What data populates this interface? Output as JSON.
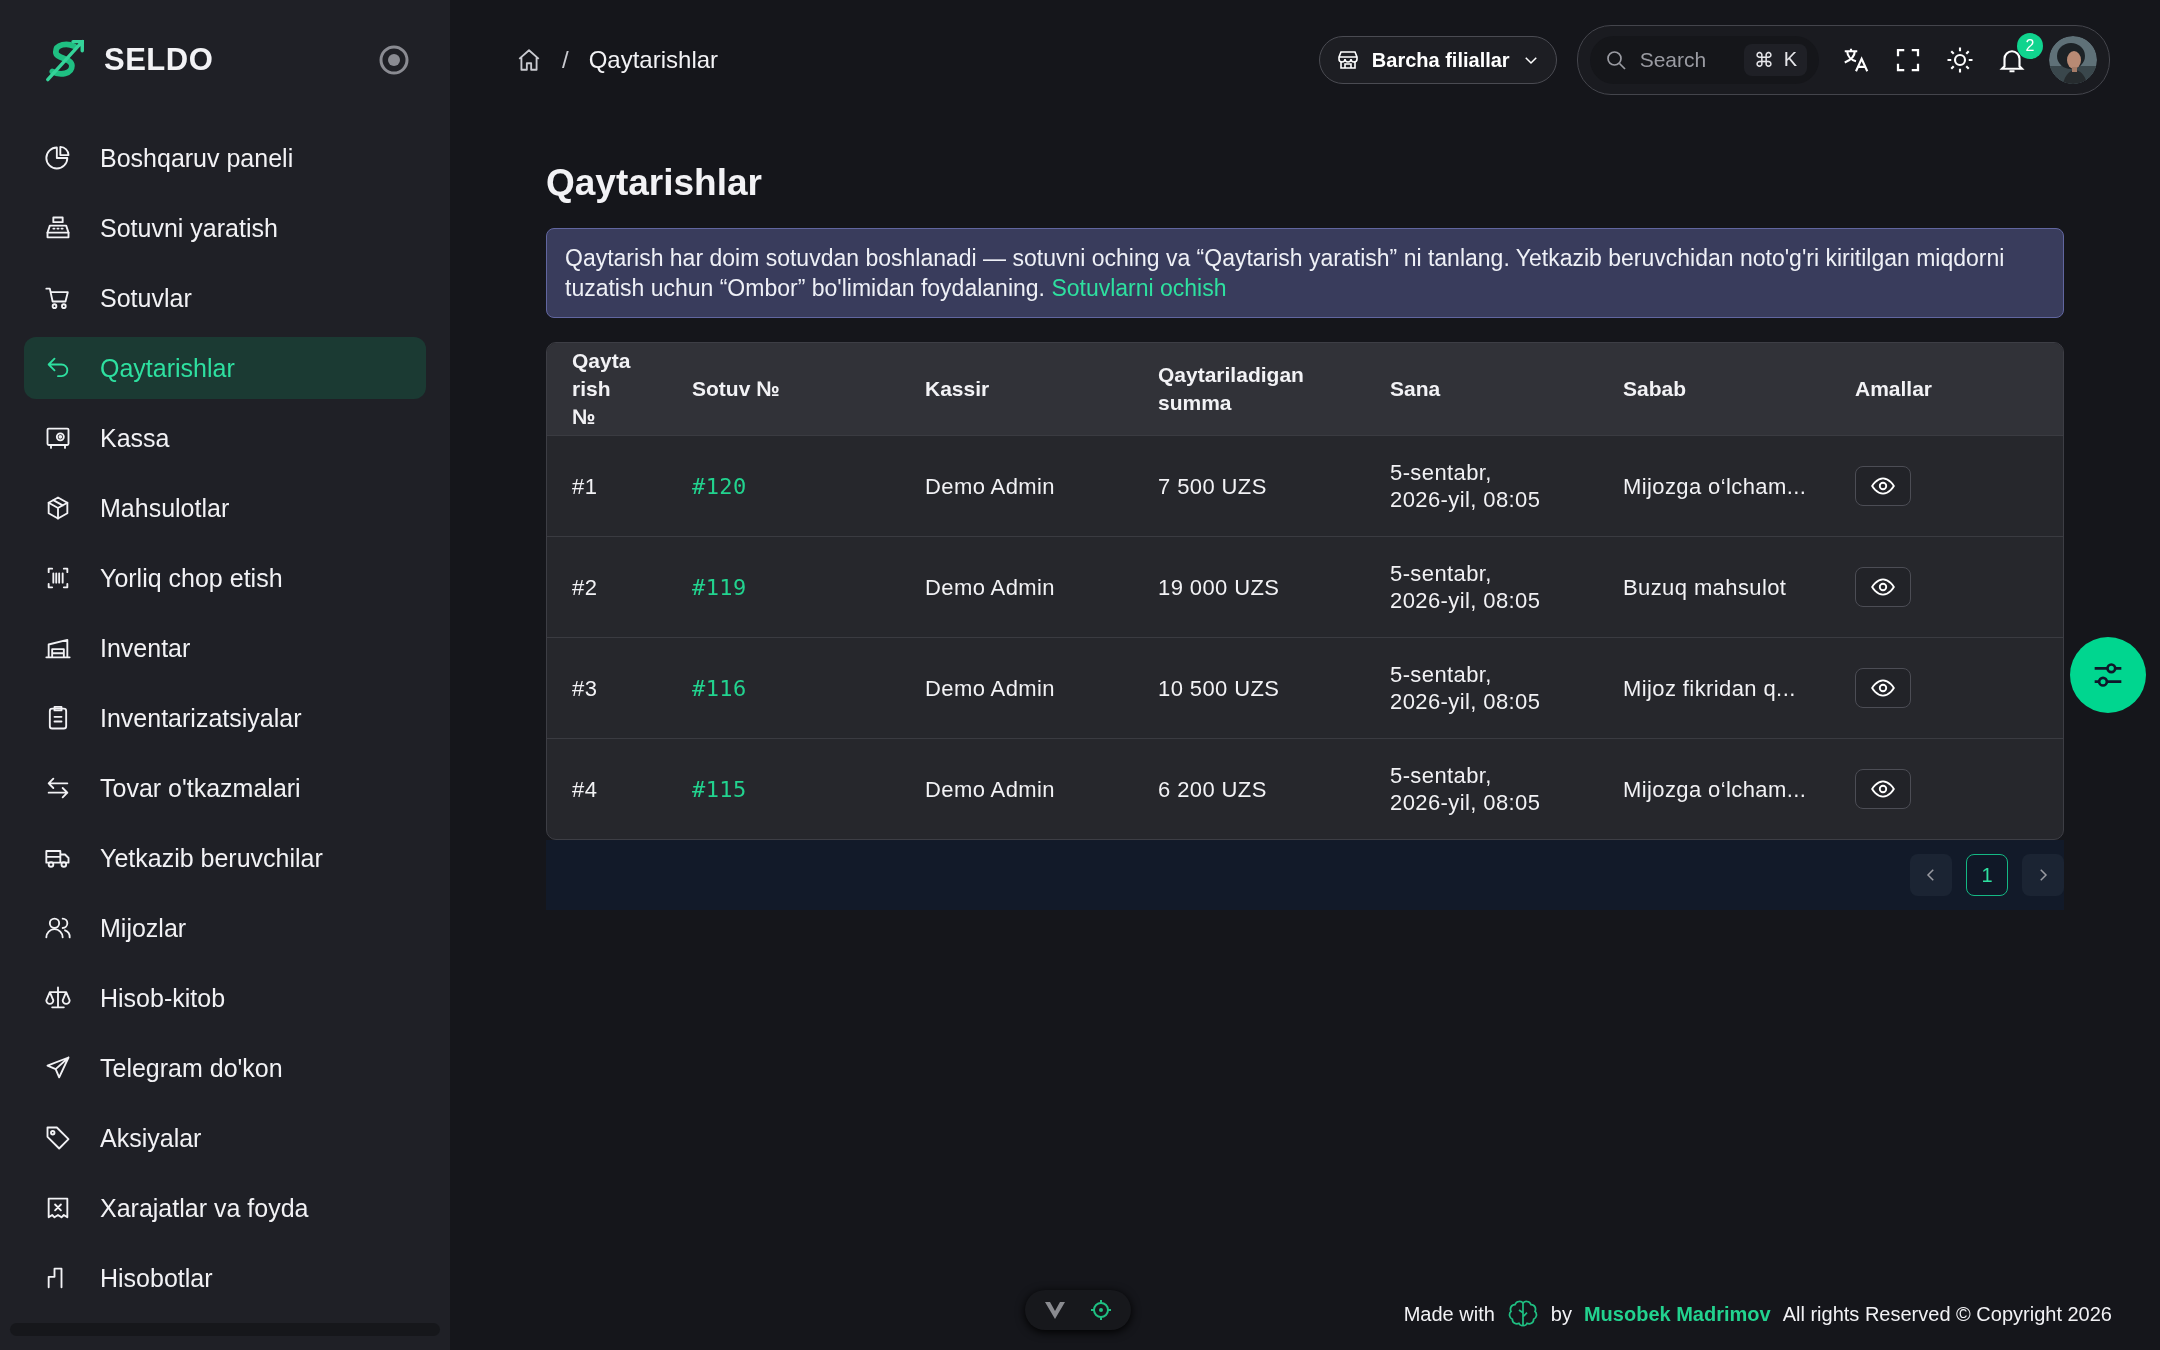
{
  "brand": {
    "name": "SELDO"
  },
  "sidebar": {
    "items": [
      {
        "label": "Boshqaruv paneli",
        "selected": false
      },
      {
        "label": "Sotuvni yaratish",
        "selected": false
      },
      {
        "label": "Sotuvlar",
        "selected": false
      },
      {
        "label": "Qaytarishlar",
        "selected": true
      },
      {
        "label": "Kassa",
        "selected": false
      },
      {
        "label": "Mahsulotlar",
        "selected": false
      },
      {
        "label": "Yorliq chop etish",
        "selected": false
      },
      {
        "label": "Inventar",
        "selected": false
      },
      {
        "label": "Inventarizatsiyalar",
        "selected": false
      },
      {
        "label": "Tovar o'tkazmalari",
        "selected": false
      },
      {
        "label": "Yetkazib beruvchilar",
        "selected": false
      },
      {
        "label": "Mijozlar",
        "selected": false
      },
      {
        "label": "Hisob-kitob",
        "selected": false
      },
      {
        "label": "Telegram do'kon",
        "selected": false
      },
      {
        "label": "Aksiyalar",
        "selected": false
      },
      {
        "label": "Xarajatlar va foyda",
        "selected": false
      },
      {
        "label": "Hisobotlar",
        "selected": false
      }
    ]
  },
  "breadcrumb": {
    "separator": "/",
    "current": "Qaytarishlar"
  },
  "branch_select": {
    "label": "Barcha filiallar"
  },
  "search": {
    "placeholder": "Search",
    "shortcut": [
      "⌘",
      "K"
    ]
  },
  "notifications": {
    "count": "2"
  },
  "page": {
    "title": "Qaytarishlar"
  },
  "notice": {
    "text": "Qaytarish har doim sotuvdan boshlanadi — sotuvni oching va “Qaytarish yaratish” ni tanlang. Yetkazib beruvchidan noto'g'ri kiritilgan miqdorni tuzatish uchun “Ombor” bo'limidan foydalaning.",
    "link": "Sotuvlarni ochish"
  },
  "table": {
    "columns": [
      "Qaytarish №",
      "Sotuv №",
      "Kassir",
      "Qaytariladigan summa",
      "Sana",
      "Sabab",
      "Amallar"
    ],
    "rows": [
      {
        "return_no": "#1",
        "sale_no": "#120",
        "cashier": "Demo Admin",
        "amount": "7 500 UZS",
        "date": "5-sentabr, 2026-yil, 08:05",
        "reason": "Mijozga o‘lcham..."
      },
      {
        "return_no": "#2",
        "sale_no": "#119",
        "cashier": "Demo Admin",
        "amount": "19 000 UZS",
        "date": "5-sentabr, 2026-yil, 08:05",
        "reason": "Buzuq mahsulot"
      },
      {
        "return_no": "#3",
        "sale_no": "#116",
        "cashier": "Demo Admin",
        "amount": "10 500 UZS",
        "date": "5-sentabr, 2026-yil, 08:05",
        "reason": "Mijoz fikridan q..."
      },
      {
        "return_no": "#4",
        "sale_no": "#115",
        "cashier": "Demo Admin",
        "amount": "6 200 UZS",
        "date": "5-sentabr, 2026-yil, 08:05",
        "reason": "Mijozga o‘lcham..."
      }
    ]
  },
  "pagination": {
    "pages": [
      {
        "label": "1",
        "selected": true
      }
    ]
  },
  "footer": {
    "made_with": "Made with",
    "by": "by",
    "author": "Musobek Madrimov",
    "copyright": "All rights Reserved © Copyright 2026"
  }
}
